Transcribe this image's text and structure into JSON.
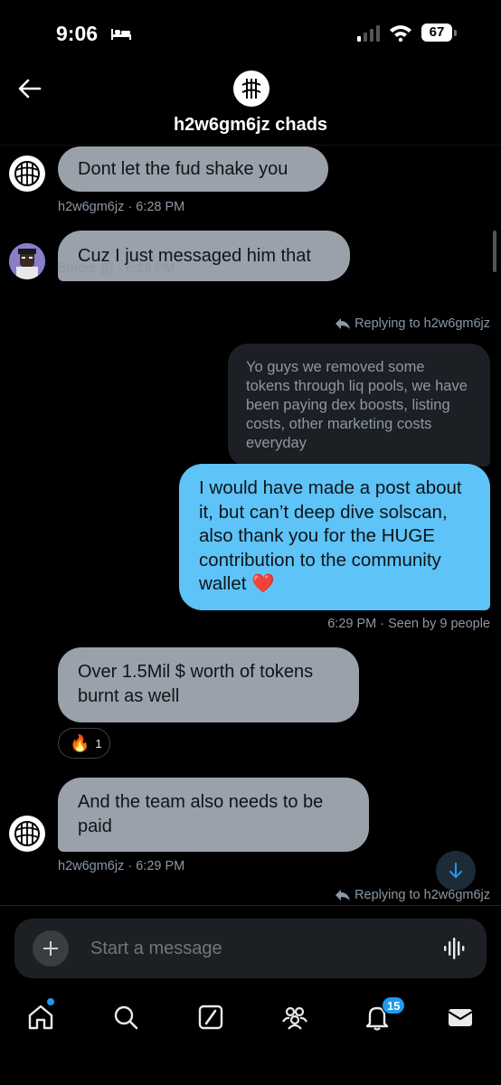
{
  "status_bar": {
    "time": "9:06",
    "battery": "67"
  },
  "header": {
    "group_name": "h2w6gm6jz chads"
  },
  "messages": [
    {
      "text": "Dont let the fud shake you",
      "meta": "h2w6gm6jz · 6:28 PM"
    },
    {
      "text": "Cuz I just messaged him that",
      "meta": "Bmore ∰ · 6:29 PM"
    },
    {
      "reply_to": "Replying to h2w6gm6jz",
      "quoted": "Yo guys we removed some tokens through liq pools, we have been paying dex boosts, listing costs, other marketing costs everyday",
      "text": "I would have made a post about it, but can’t deep dive solscan, also thank you for the HUGE contribution to the community wallet ❤️",
      "meta": "6:29 PM · Seen by 9 people"
    },
    {
      "text": "Over 1.5Mil $ worth of tokens burnt as well",
      "reaction_emoji": "🔥",
      "reaction_count": "1"
    },
    {
      "text": "And the team also needs to be paid",
      "meta": "h2w6gm6jz · 6:29 PM"
    }
  ],
  "footer_reply": "Replying to h2w6gm6jz",
  "composer": {
    "placeholder": "Start a message"
  },
  "nav": {
    "notification_count": "15"
  },
  "colors": {
    "accent": "#1d9bf0",
    "outgoing_bubble": "#5ec3f7",
    "incoming_bubble": "#9aa1aa"
  }
}
